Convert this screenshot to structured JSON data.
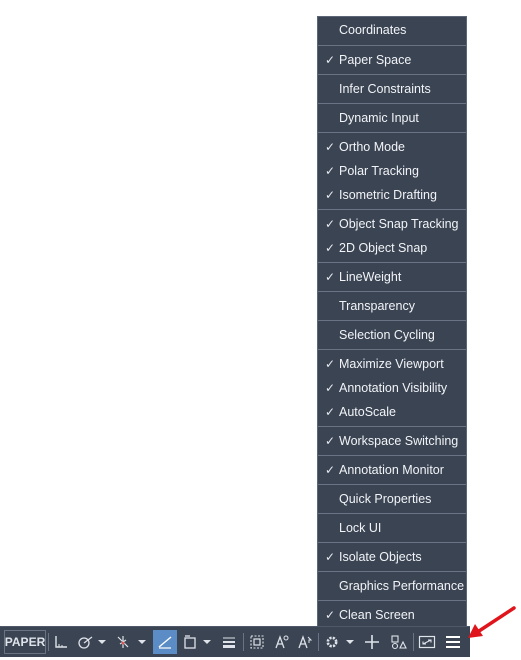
{
  "menu": {
    "items": [
      {
        "label": "Coordinates",
        "checked": false
      },
      {
        "label": "Paper Space",
        "checked": true
      },
      {
        "label": "Infer Constraints",
        "checked": false
      },
      {
        "label": "Dynamic Input",
        "checked": false
      },
      {
        "label": "Ortho Mode",
        "checked": true
      },
      {
        "label": "Polar Tracking",
        "checked": true
      },
      {
        "label": "Isometric Drafting",
        "checked": true
      },
      {
        "label": "Object Snap Tracking",
        "checked": true
      },
      {
        "label": "2D Object Snap",
        "checked": true
      },
      {
        "label": "LineWeight",
        "checked": true
      },
      {
        "label": "Transparency",
        "checked": false
      },
      {
        "label": "Selection Cycling",
        "checked": false
      },
      {
        "label": "Maximize Viewport",
        "checked": true
      },
      {
        "label": "Annotation Visibility",
        "checked": true
      },
      {
        "label": "AutoScale",
        "checked": true
      },
      {
        "label": "Workspace Switching",
        "checked": true
      },
      {
        "label": "Annotation Monitor",
        "checked": true
      },
      {
        "label": "Quick Properties",
        "checked": false
      },
      {
        "label": "Lock UI",
        "checked": false
      },
      {
        "label": "Isolate Objects",
        "checked": true
      },
      {
        "label": "Graphics Performance",
        "checked": false
      },
      {
        "label": "Clean Screen",
        "checked": true
      }
    ],
    "check_glyph": "✓"
  },
  "statusbar": {
    "paper_label": "PAPER",
    "icons": [
      "ortho-grid-icon",
      "polar-tracking-icon",
      "dropdown-arrow-icon",
      "isometric-icon",
      "dropdown-arrow-icon",
      "object-snap-tracking-icon",
      "object-snap-icon",
      "dropdown-arrow-icon",
      "lineweight-icon",
      "selection-cycling-icon",
      "annotation-visibility-icon",
      "autoscale-icon",
      "workspace-gear-icon",
      "dropdown-arrow-icon",
      "annotation-monitor-plus-icon",
      "isolate-objects-icon",
      "clean-screen-icon",
      "customization-menu-icon"
    ],
    "active_color": "#5b8cc6"
  },
  "colors": {
    "menu_background": "#3b4453",
    "menu_text": "#f2f4f7",
    "arrow": "#e0151b"
  }
}
